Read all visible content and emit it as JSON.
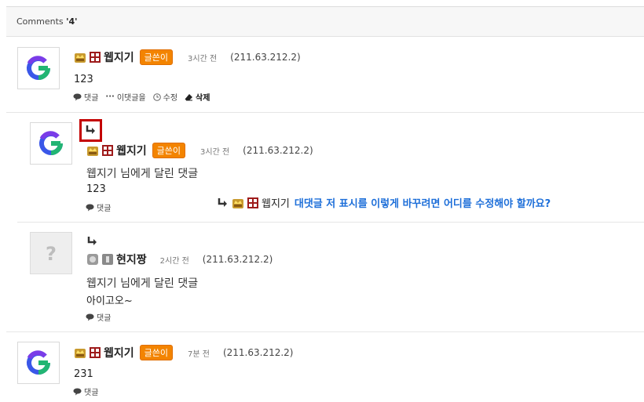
{
  "header": {
    "prefix": "Comments ",
    "count": "'4'"
  },
  "comments": [
    {
      "nickname": "웹지기",
      "badge": "글쓴이",
      "time": "3시간 전",
      "ip": "(211.63.212.2)",
      "content": "123",
      "actions": {
        "reply": "댓글",
        "more": "이댓글을",
        "edit": "수정",
        "delete": "삭제"
      }
    },
    {
      "nickname": "웹지기",
      "badge": "글쓴이",
      "time": "3시간 전",
      "ip": "(211.63.212.2)",
      "reply_to": "웹지기 님에게 달린 댓글",
      "content": "123",
      "actions": {
        "reply": "댓글"
      }
    },
    {
      "nickname": "현지짱",
      "time": "2시간 전",
      "ip": "(211.63.212.2)",
      "reply_to": "웹지기 님에게 달린 댓글",
      "content": "아이고오~",
      "actions": {
        "reply": "댓글"
      }
    },
    {
      "nickname": "웹지기",
      "badge": "글쓴이",
      "time": "7분 전",
      "ip": "(211.63.212.2)",
      "content": "231",
      "actions": {
        "reply": "댓글"
      }
    }
  ],
  "annotation": {
    "arrow": "↳",
    "nickname": "웹지기",
    "question": "대댓글 저 표시를 이렇게 바꾸려면 어디를 수정해야 할까요?"
  },
  "colors": {
    "badge": "#f38400",
    "highlight_box": "#c40000",
    "question_text": "#1e6fd9"
  },
  "icons": [
    "google-g-logo",
    "question-avatar-icon",
    "level-crown-icon",
    "level-grid-icon",
    "chat-bubble-icon",
    "dots-icon",
    "clock-icon",
    "eraser-icon",
    "reply-arrow-icon"
  ]
}
